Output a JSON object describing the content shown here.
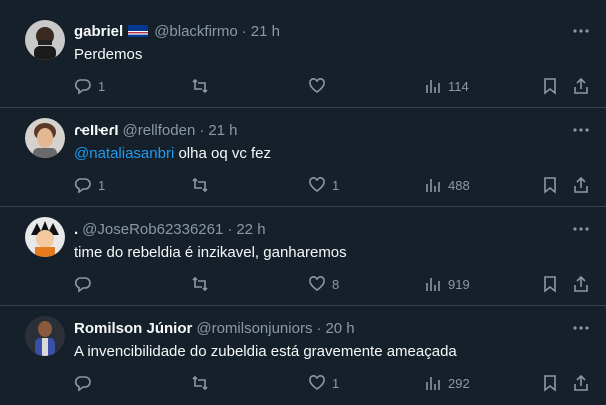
{
  "colors": {
    "background": "#15202b",
    "divider": "#38444d",
    "text": "#f7f9f9",
    "muted": "#8b98a5",
    "link": "#1d9bf0"
  },
  "tweets": [
    {
      "name": "gabriel",
      "has_flag": true,
      "handle": "@blackfirmo",
      "time": "21 h",
      "text_parts": [
        {
          "type": "text",
          "value": "Perdemos"
        }
      ],
      "replies": "1",
      "retweets": "",
      "likes": "",
      "views": "114"
    },
    {
      "name": "ɾҽӀӀҽɾӀ",
      "has_flag": false,
      "handle": "@rellfoden",
      "time": "21 h",
      "text_parts": [
        {
          "type": "mention",
          "value": "@nataliasanbri"
        },
        {
          "type": "text",
          "value": " olha oq vc fez"
        }
      ],
      "replies": "1",
      "retweets": "",
      "likes": "1",
      "views": "488"
    },
    {
      "name": ".",
      "has_flag": false,
      "handle": "@JoseRob62336261",
      "time": "22 h",
      "text_parts": [
        {
          "type": "text",
          "value": "time do rebeldia é inzikavel, ganharemos"
        }
      ],
      "replies": "",
      "retweets": "",
      "likes": "8",
      "views": "919"
    },
    {
      "name": "Romilson Júnior",
      "has_flag": false,
      "handle": "@romilsonjuniors",
      "time": "20 h",
      "text_parts": [
        {
          "type": "text",
          "value": "A invencibilidade do zubeldia está gravemente ameaçada"
        }
      ],
      "replies": "",
      "retweets": "",
      "likes": "1",
      "views": "292"
    }
  ]
}
